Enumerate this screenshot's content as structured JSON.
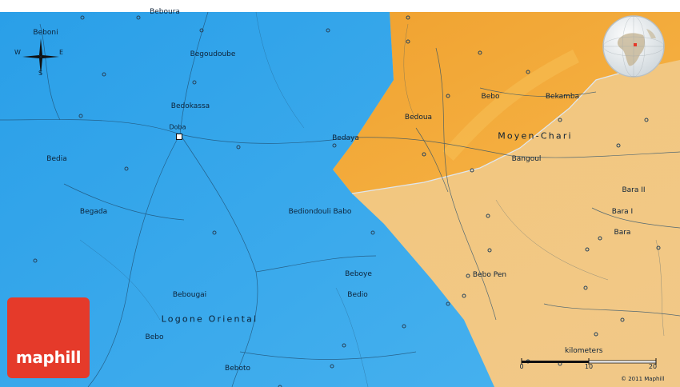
{
  "map": {
    "regions": [
      {
        "name": "Logone Oriental",
        "color": "#3aa6e8"
      },
      {
        "name": "Moyen-Chari",
        "color": "#f3a93a"
      },
      {
        "name": "",
        "color": "#f2c77e"
      }
    ],
    "places": [
      {
        "name": "Beboura"
      },
      {
        "name": "Beboni"
      },
      {
        "name": "Begoudoube"
      },
      {
        "name": "Bedokassa"
      },
      {
        "name": "Doba"
      },
      {
        "name": "Bedia"
      },
      {
        "name": "Begada"
      },
      {
        "name": "Bedaya"
      },
      {
        "name": "Bediondouli Babo"
      },
      {
        "name": "Beboye"
      },
      {
        "name": "Bedio"
      },
      {
        "name": "Bebougai"
      },
      {
        "name": "Bebo"
      },
      {
        "name": "Beboto"
      },
      {
        "name": "Bedoua"
      },
      {
        "name": "Bebo"
      },
      {
        "name": "Bekamba"
      },
      {
        "name": "Bangoul"
      },
      {
        "name": "Bara II"
      },
      {
        "name": "Bara I"
      },
      {
        "name": "Bara"
      },
      {
        "name": "Bebo Pen"
      }
    ],
    "compass": {
      "north": "N",
      "south": "S",
      "east": "E",
      "west": "W"
    },
    "scale": {
      "unit": "kilometers",
      "ticks": [
        "0",
        "10",
        "20"
      ]
    },
    "copyright": "© 2011 Maphill",
    "logo": "maphill",
    "inset_globe": {
      "icon": "globe-locator-icon",
      "ocean_color": "#dfe8ee",
      "land_color": "#c8b99a"
    }
  }
}
